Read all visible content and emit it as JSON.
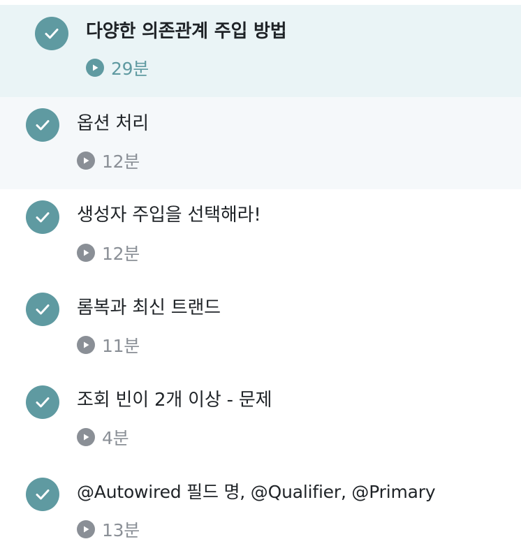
{
  "lectures": [
    {
      "title": "다양한 의존관계 주입 방법",
      "duration": "29분",
      "state": "active",
      "completed": true
    },
    {
      "title": "옵션 처리",
      "duration": "12분",
      "state": "hovered",
      "completed": true
    },
    {
      "title": "생성자 주입을 선택해라!",
      "duration": "12분",
      "state": "normal",
      "completed": true
    },
    {
      "title": "롬복과 최신 트랜드",
      "duration": "11분",
      "state": "normal",
      "completed": true
    },
    {
      "title": "조회 빈이 2개 이상 - 문제",
      "duration": "4분",
      "state": "normal",
      "completed": true
    },
    {
      "title": "@Autowired 필드 명, @Qualifier, @Primary",
      "duration": "13분",
      "state": "normal",
      "completed": true
    }
  ],
  "colors": {
    "accent": "#5f9aa1",
    "active_bg": "#eaf4f6",
    "hover_bg": "#f5f8fa",
    "title_text": "#1f2327",
    "muted_text": "#8a8f96"
  },
  "icons": {
    "completed": "check-circle-icon",
    "duration": "play-circle-icon"
  }
}
